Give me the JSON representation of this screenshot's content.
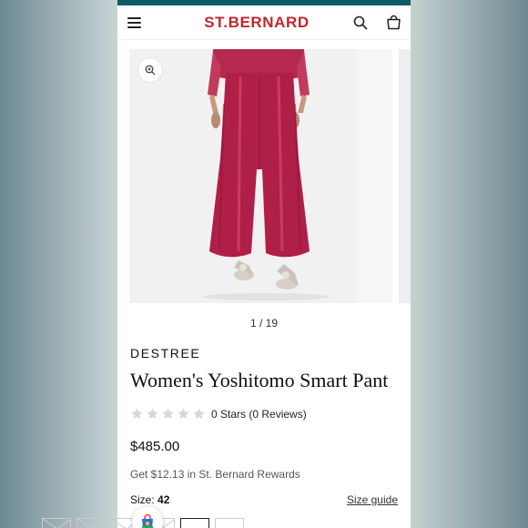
{
  "header": {
    "logo": "ST.BERNARD",
    "menu_icon": "hamburger-menu-icon",
    "search_icon": "search-icon",
    "bag_icon": "shopping-bag-icon",
    "brand_color": "#c1272d",
    "strip_color": "#0f5d63"
  },
  "gallery": {
    "pager": "1 / 19",
    "zoom_icon": "zoom-in-icon",
    "garment_color": "#b01f47"
  },
  "product": {
    "brand": "DESTREE",
    "title": "Women's Yoshitomo Smart Pant",
    "rating_text": "0 Stars (0 Reviews)",
    "rating_value": 0,
    "rating_max": 5,
    "price": "$485.00",
    "rewards": "Get $12.13 in St. Bernard Rewards"
  },
  "size": {
    "label": "Size:",
    "selected": "42",
    "guide": "Size guide"
  }
}
